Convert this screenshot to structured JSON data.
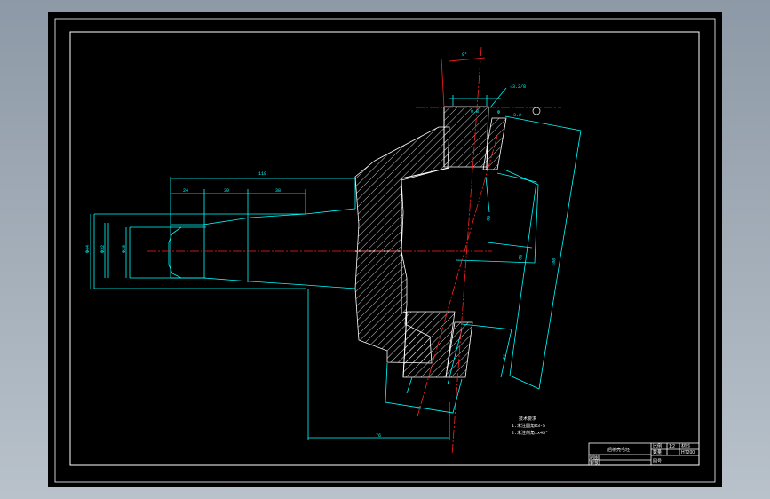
{
  "drawing": {
    "top_angle": "9°",
    "surface_callout": "◁3.2/8",
    "roughness_a": "0.8",
    "roughness_b": "3.2",
    "symbol_left": "Φ",
    "dims": {
      "d_outer": "Φ44",
      "d_mid": "Φ32",
      "d_bore": "Φ28",
      "len_total": "119",
      "len_a": "24",
      "len_b": "30",
      "len_c": "38",
      "flange_a": "60",
      "flange_b": "88",
      "flange_c": "180",
      "flange_d": "11",
      "bottom_a": "46",
      "bottom_b": "76"
    },
    "notes": [
      "技术要求",
      "1.未注圆角R3-5",
      "2.未注倒角1x45°"
    ]
  },
  "title_block": {
    "title": "后桥壳毛坯",
    "scale_label": "比例",
    "scale_value": "1:2",
    "qty_label": "数量",
    "material_label": "材料",
    "material_value": "HT200",
    "designer_label": "制图",
    "checker_label": "审核",
    "sheet_label": "图号"
  }
}
